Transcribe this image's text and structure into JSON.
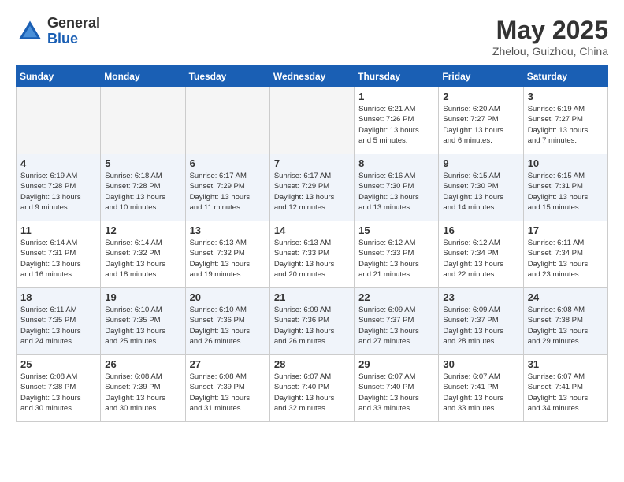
{
  "header": {
    "logo_general": "General",
    "logo_blue": "Blue",
    "month_title": "May 2025",
    "location": "Zhelou, Guizhou, China"
  },
  "weekdays": [
    "Sunday",
    "Monday",
    "Tuesday",
    "Wednesday",
    "Thursday",
    "Friday",
    "Saturday"
  ],
  "weeks": [
    [
      {
        "day": "",
        "info": ""
      },
      {
        "day": "",
        "info": ""
      },
      {
        "day": "",
        "info": ""
      },
      {
        "day": "",
        "info": ""
      },
      {
        "day": "1",
        "info": "Sunrise: 6:21 AM\nSunset: 7:26 PM\nDaylight: 13 hours\nand 5 minutes."
      },
      {
        "day": "2",
        "info": "Sunrise: 6:20 AM\nSunset: 7:27 PM\nDaylight: 13 hours\nand 6 minutes."
      },
      {
        "day": "3",
        "info": "Sunrise: 6:19 AM\nSunset: 7:27 PM\nDaylight: 13 hours\nand 7 minutes."
      }
    ],
    [
      {
        "day": "4",
        "info": "Sunrise: 6:19 AM\nSunset: 7:28 PM\nDaylight: 13 hours\nand 9 minutes."
      },
      {
        "day": "5",
        "info": "Sunrise: 6:18 AM\nSunset: 7:28 PM\nDaylight: 13 hours\nand 10 minutes."
      },
      {
        "day": "6",
        "info": "Sunrise: 6:17 AM\nSunset: 7:29 PM\nDaylight: 13 hours\nand 11 minutes."
      },
      {
        "day": "7",
        "info": "Sunrise: 6:17 AM\nSunset: 7:29 PM\nDaylight: 13 hours\nand 12 minutes."
      },
      {
        "day": "8",
        "info": "Sunrise: 6:16 AM\nSunset: 7:30 PM\nDaylight: 13 hours\nand 13 minutes."
      },
      {
        "day": "9",
        "info": "Sunrise: 6:15 AM\nSunset: 7:30 PM\nDaylight: 13 hours\nand 14 minutes."
      },
      {
        "day": "10",
        "info": "Sunrise: 6:15 AM\nSunset: 7:31 PM\nDaylight: 13 hours\nand 15 minutes."
      }
    ],
    [
      {
        "day": "11",
        "info": "Sunrise: 6:14 AM\nSunset: 7:31 PM\nDaylight: 13 hours\nand 16 minutes."
      },
      {
        "day": "12",
        "info": "Sunrise: 6:14 AM\nSunset: 7:32 PM\nDaylight: 13 hours\nand 18 minutes."
      },
      {
        "day": "13",
        "info": "Sunrise: 6:13 AM\nSunset: 7:32 PM\nDaylight: 13 hours\nand 19 minutes."
      },
      {
        "day": "14",
        "info": "Sunrise: 6:13 AM\nSunset: 7:33 PM\nDaylight: 13 hours\nand 20 minutes."
      },
      {
        "day": "15",
        "info": "Sunrise: 6:12 AM\nSunset: 7:33 PM\nDaylight: 13 hours\nand 21 minutes."
      },
      {
        "day": "16",
        "info": "Sunrise: 6:12 AM\nSunset: 7:34 PM\nDaylight: 13 hours\nand 22 minutes."
      },
      {
        "day": "17",
        "info": "Sunrise: 6:11 AM\nSunset: 7:34 PM\nDaylight: 13 hours\nand 23 minutes."
      }
    ],
    [
      {
        "day": "18",
        "info": "Sunrise: 6:11 AM\nSunset: 7:35 PM\nDaylight: 13 hours\nand 24 minutes."
      },
      {
        "day": "19",
        "info": "Sunrise: 6:10 AM\nSunset: 7:35 PM\nDaylight: 13 hours\nand 25 minutes."
      },
      {
        "day": "20",
        "info": "Sunrise: 6:10 AM\nSunset: 7:36 PM\nDaylight: 13 hours\nand 26 minutes."
      },
      {
        "day": "21",
        "info": "Sunrise: 6:09 AM\nSunset: 7:36 PM\nDaylight: 13 hours\nand 26 minutes."
      },
      {
        "day": "22",
        "info": "Sunrise: 6:09 AM\nSunset: 7:37 PM\nDaylight: 13 hours\nand 27 minutes."
      },
      {
        "day": "23",
        "info": "Sunrise: 6:09 AM\nSunset: 7:37 PM\nDaylight: 13 hours\nand 28 minutes."
      },
      {
        "day": "24",
        "info": "Sunrise: 6:08 AM\nSunset: 7:38 PM\nDaylight: 13 hours\nand 29 minutes."
      }
    ],
    [
      {
        "day": "25",
        "info": "Sunrise: 6:08 AM\nSunset: 7:38 PM\nDaylight: 13 hours\nand 30 minutes."
      },
      {
        "day": "26",
        "info": "Sunrise: 6:08 AM\nSunset: 7:39 PM\nDaylight: 13 hours\nand 30 minutes."
      },
      {
        "day": "27",
        "info": "Sunrise: 6:08 AM\nSunset: 7:39 PM\nDaylight: 13 hours\nand 31 minutes."
      },
      {
        "day": "28",
        "info": "Sunrise: 6:07 AM\nSunset: 7:40 PM\nDaylight: 13 hours\nand 32 minutes."
      },
      {
        "day": "29",
        "info": "Sunrise: 6:07 AM\nSunset: 7:40 PM\nDaylight: 13 hours\nand 33 minutes."
      },
      {
        "day": "30",
        "info": "Sunrise: 6:07 AM\nSunset: 7:41 PM\nDaylight: 13 hours\nand 33 minutes."
      },
      {
        "day": "31",
        "info": "Sunrise: 6:07 AM\nSunset: 7:41 PM\nDaylight: 13 hours\nand 34 minutes."
      }
    ]
  ]
}
